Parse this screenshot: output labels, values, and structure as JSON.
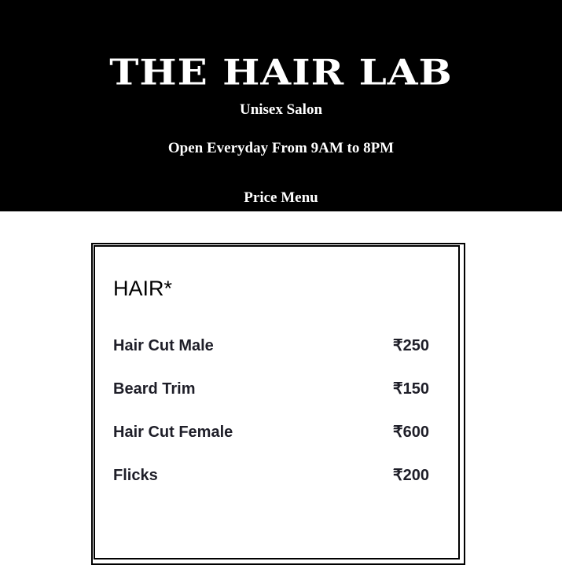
{
  "header": {
    "brand": "THE HAIR LAB",
    "tagline": "Unisex Salon",
    "hours": "Open Everyday From 9AM to 8PM",
    "menu_link": "Price Menu"
  },
  "menu": {
    "section_title": "HAIR*",
    "items": [
      {
        "name": "Hair Cut Male",
        "price": "₹250"
      },
      {
        "name": "Beard Trim",
        "price": "₹150"
      },
      {
        "name": "Hair Cut Female",
        "price": "₹600"
      },
      {
        "name": "Flicks",
        "price": "₹200"
      }
    ]
  },
  "colors": {
    "header_background": "#000000",
    "header_text": "#ffffff",
    "item_text": "#1e1e28"
  }
}
